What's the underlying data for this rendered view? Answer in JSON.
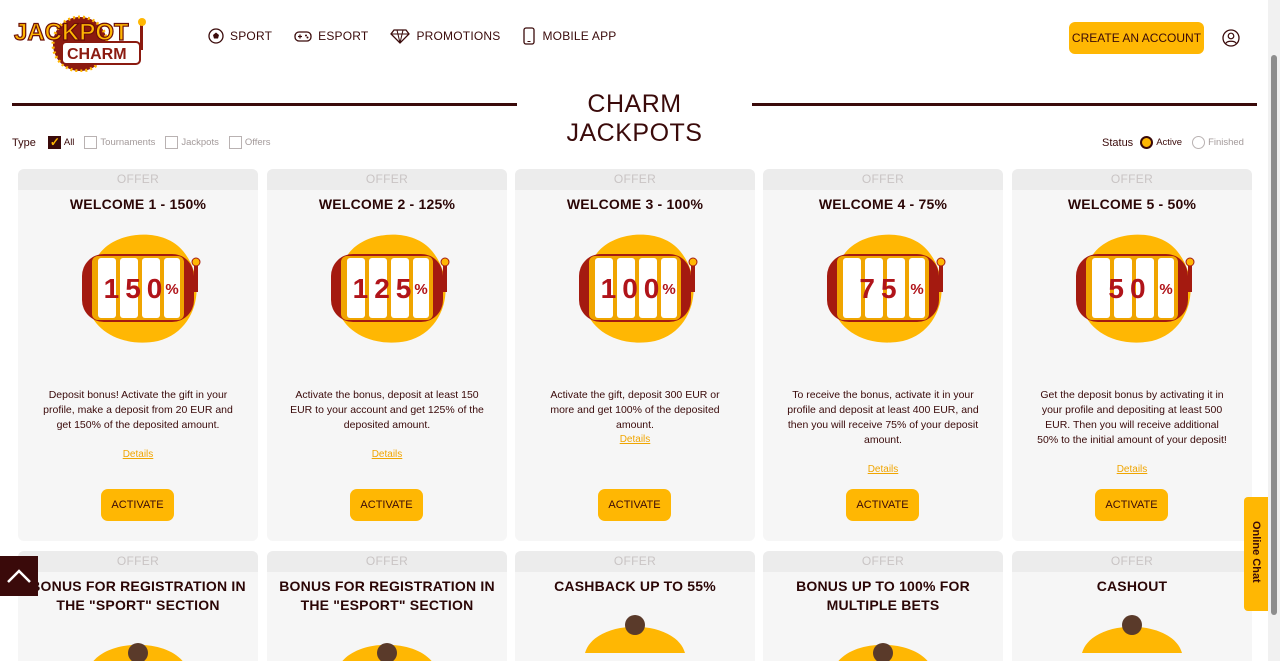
{
  "brand": {
    "logo_line1": "JACKPOT",
    "logo_line2": "CHARM"
  },
  "nav": [
    {
      "label": "SPORT",
      "icon": "soccer-ball-icon"
    },
    {
      "label": "ESPORT",
      "icon": "gamepad-icon"
    },
    {
      "label": "PROMOTIONS",
      "icon": "diamond-icon"
    },
    {
      "label": "MOBILE APP",
      "icon": "smartphone-icon"
    }
  ],
  "header": {
    "create_account_label": "CREATE AN ACCOUNT",
    "user_icon": "user-icon"
  },
  "page": {
    "title": "CHARM JACKPOTS"
  },
  "filters": {
    "type_label": "Type",
    "types": [
      {
        "label": "All",
        "checked": true
      },
      {
        "label": "Tournaments",
        "checked": false
      },
      {
        "label": "Jackpots",
        "checked": false
      },
      {
        "label": "Offers",
        "checked": false
      }
    ],
    "status_label": "Status",
    "statuses": [
      {
        "label": "Active",
        "checked": true
      },
      {
        "label": "Finished",
        "checked": false
      }
    ]
  },
  "cards": [
    {
      "tag": "OFFER",
      "title": "WELCOME 1 - 150%",
      "percent": "150",
      "description": "Deposit bonus! Activate the gift in your profile, make a deposit from 20 EUR and get 150% of the deposited amount.",
      "details_label": "Details",
      "button_label": "ACTIVATE"
    },
    {
      "tag": "OFFER",
      "title": "WELCOME 2 - 125%",
      "percent": "125",
      "description": "Activate the bonus, deposit at least 150 EUR to your account and get 125% of the deposited amount.",
      "details_label": "Details",
      "button_label": "ACTIVATE"
    },
    {
      "tag": "OFFER",
      "title": "WELCOME 3 - 100%",
      "percent": "100",
      "description": "Activate the gift, deposit 300 EUR or more and get 100% of the deposited amount.",
      "details_label": "Details",
      "button_label": "ACTIVATE"
    },
    {
      "tag": "OFFER",
      "title": "WELCOME 4 - 75%",
      "percent": "75",
      "description": "To receive the bonus, activate it in your profile and deposit at least 400 EUR, and then you will receive 75% of your deposit amount.",
      "details_label": "Details",
      "button_label": "ACTIVATE"
    },
    {
      "tag": "OFFER",
      "title": "WELCOME 5 - 50%",
      "percent": "50",
      "description": "Get the deposit bonus by activating it in your profile and depositing at least 500 EUR. Then you will receive additional 50% to the initial amount of your deposit!",
      "details_label": "Details",
      "button_label": "ACTIVATE"
    }
  ],
  "cards_row2": [
    {
      "tag": "OFFER",
      "title": "BONUS FOR REGISTRATION IN THE \"SPORT\" SECTION"
    },
    {
      "tag": "OFFER",
      "title": "BONUS FOR REGISTRATION IN THE \"ESPORT\" SECTION"
    },
    {
      "tag": "OFFER",
      "title": "CASHBACK UP TO 55%"
    },
    {
      "tag": "OFFER",
      "title": "BONUS UP TO 100% FOR MULTIPLE BETS"
    },
    {
      "tag": "OFFER",
      "title": "CASHOUT"
    }
  ],
  "chat": {
    "label": "Online Chat"
  },
  "colors": {
    "accent": "#ffb703",
    "dark": "#3a0a0a",
    "card_bg": "#f6f6f6"
  }
}
